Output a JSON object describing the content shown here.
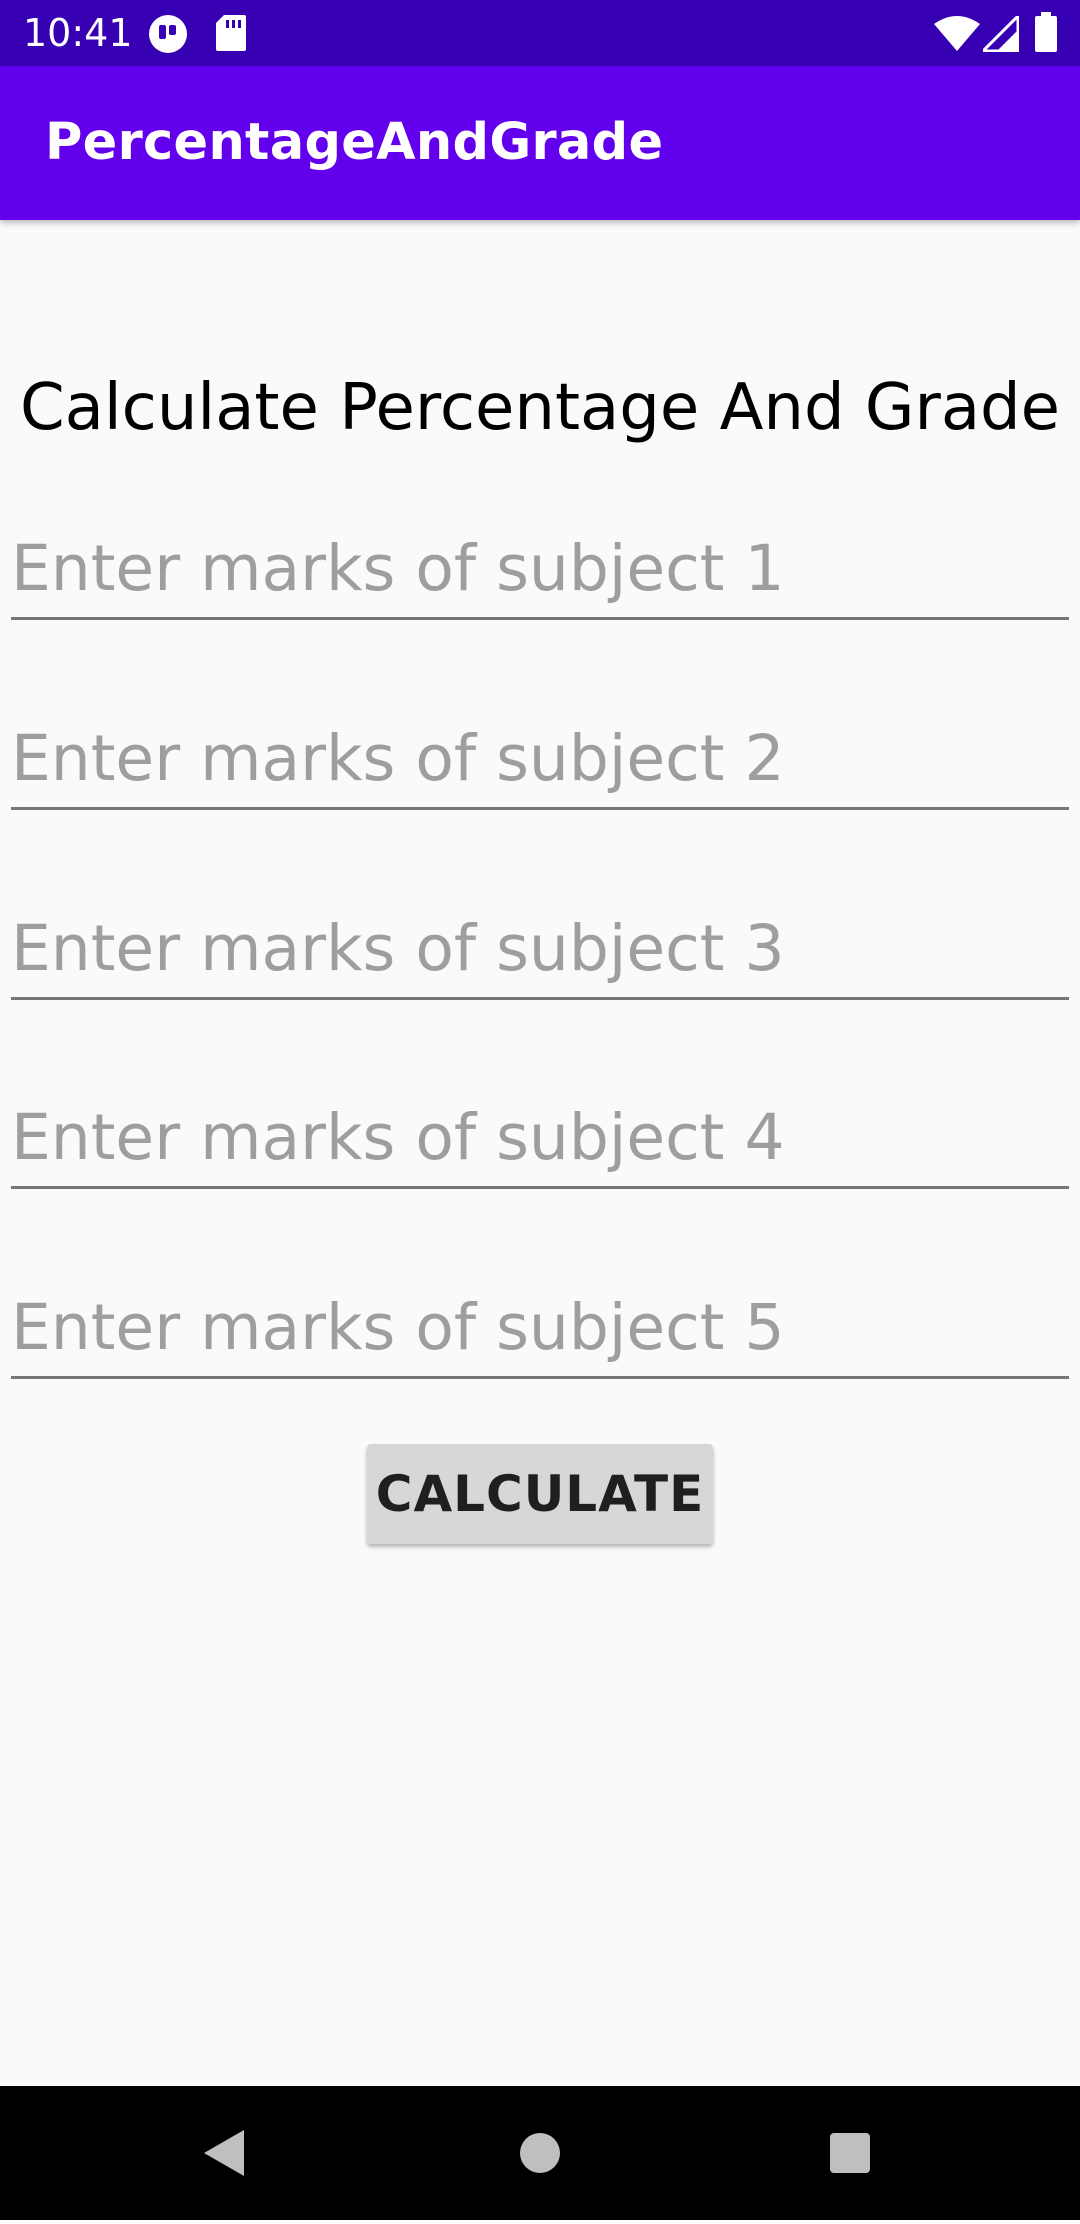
{
  "status_bar": {
    "time": "10:41",
    "left_icons": [
      "app-notification-icon",
      "sd-card-icon"
    ],
    "right_icons": [
      "wifi-icon",
      "cellular-signal-icon",
      "battery-icon"
    ],
    "background_color": "#3700b3"
  },
  "app_bar": {
    "title": "PercentageAndGrade",
    "background_color": "#6200ee"
  },
  "main": {
    "heading": "Calculate Percentage And Grade",
    "fields": [
      {
        "placeholder": "Enter marks of subject 1",
        "value": ""
      },
      {
        "placeholder": "Enter marks of subject 2",
        "value": ""
      },
      {
        "placeholder": "Enter marks of subject 3",
        "value": ""
      },
      {
        "placeholder": "Enter marks of subject 4",
        "value": ""
      },
      {
        "placeholder": "Enter marks of subject 5",
        "value": ""
      }
    ],
    "calculate_label": "CALCULATE"
  },
  "nav_bar": {
    "buttons": [
      "back-icon",
      "home-icon",
      "recents-icon"
    ]
  }
}
